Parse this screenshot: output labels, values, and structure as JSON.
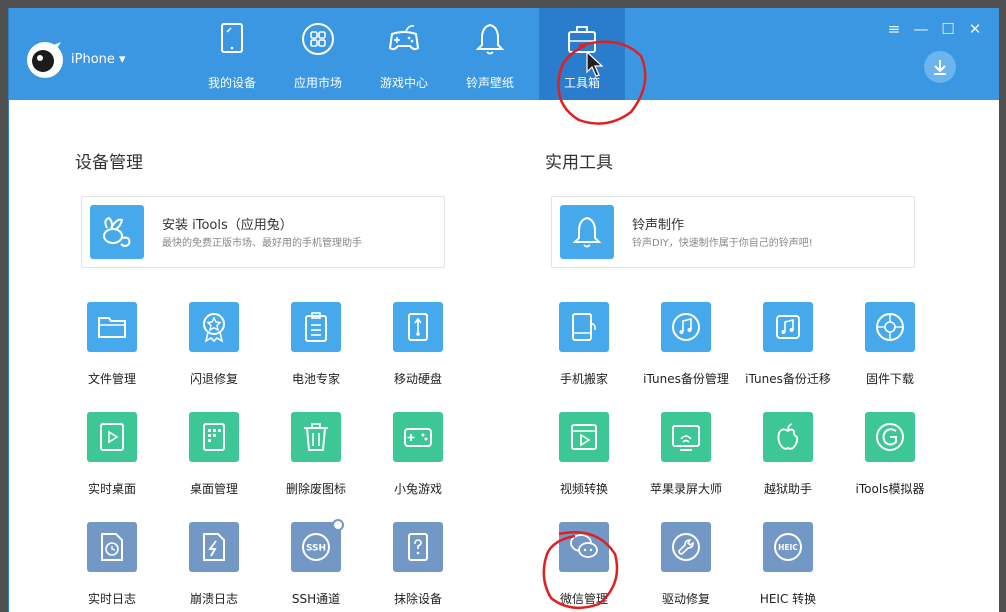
{
  "app": {
    "device_name": "iPhone ▾"
  },
  "nav": [
    {
      "label": "我的设备",
      "icon": "tablet-icon"
    },
    {
      "label": "应用市场",
      "icon": "apps-icon"
    },
    {
      "label": "游戏中心",
      "icon": "gamepad-icon"
    },
    {
      "label": "铃声壁纸",
      "icon": "bell-icon"
    },
    {
      "label": "工具箱",
      "icon": "toolbox-icon",
      "active": true
    }
  ],
  "window_controls": {
    "menu": "≡",
    "minimize": "—",
    "maximize": "☐",
    "close": "✕"
  },
  "device_management": {
    "title": "设备管理",
    "feature": {
      "title": "安装 iTools（应用兔）",
      "subtitle": "最快的免费正版市场、最好用的手机管理助手"
    },
    "tools": [
      {
        "label": "文件管理",
        "icon": "folder-icon",
        "color": "#46a9ec"
      },
      {
        "label": "闪退修复",
        "icon": "badge-icon",
        "color": "#46a9ec"
      },
      {
        "label": "电池专家",
        "icon": "clipboard-icon",
        "color": "#46a9ec"
      },
      {
        "label": "移动硬盘",
        "icon": "usb-drive-icon",
        "color": "#46a9ec"
      },
      {
        "label": "实时桌面",
        "icon": "play-screen-icon",
        "color": "#3dc795"
      },
      {
        "label": "桌面管理",
        "icon": "grid-icon",
        "color": "#3dc795"
      },
      {
        "label": "删除废图标",
        "icon": "trash-icon",
        "color": "#3dc795"
      },
      {
        "label": "小兔游戏",
        "icon": "gamepad-icon",
        "color": "#3dc795"
      },
      {
        "label": "实时日志",
        "icon": "clock-doc-icon",
        "color": "#7398c6"
      },
      {
        "label": "崩溃日志",
        "icon": "crash-doc-icon",
        "color": "#7398c6"
      },
      {
        "label": "SSH通道",
        "icon": "ssh-icon",
        "color": "#7398c6",
        "badge_text": "SSH"
      },
      {
        "label": "抹除设备",
        "icon": "erase-device-icon",
        "color": "#7398c6"
      }
    ]
  },
  "utilities": {
    "title": "实用工具",
    "feature": {
      "title": "铃声制作",
      "subtitle": "铃声DIY，快速制作属于你自己的铃声吧!"
    },
    "tools": [
      {
        "label": "手机搬家",
        "icon": "phone-transfer-icon",
        "color": "#46a9ec"
      },
      {
        "label": "iTunes备份管理",
        "icon": "music-backup-icon",
        "color": "#46a9ec"
      },
      {
        "label": "iTunes备份迁移",
        "icon": "music-migrate-icon",
        "color": "#46a9ec"
      },
      {
        "label": "固件下载",
        "icon": "firmware-icon",
        "color": "#46a9ec"
      },
      {
        "label": "视频转换",
        "icon": "video-icon",
        "color": "#3dc795"
      },
      {
        "label": "苹果录屏大师",
        "icon": "screen-cast-icon",
        "color": "#3dc795"
      },
      {
        "label": "越狱助手",
        "icon": "apple-icon",
        "color": "#3dc795"
      },
      {
        "label": "iTools模拟器",
        "icon": "emulator-icon",
        "color": "#3dc795"
      },
      {
        "label": "微信管理",
        "icon": "wechat-icon",
        "color": "#7398c6"
      },
      {
        "label": "驱动修复",
        "icon": "wrench-icon",
        "color": "#7398c6"
      },
      {
        "label": "HEIC 转换",
        "icon": "heic-icon",
        "color": "#7398c6",
        "badge_text": "HEIC"
      }
    ]
  }
}
